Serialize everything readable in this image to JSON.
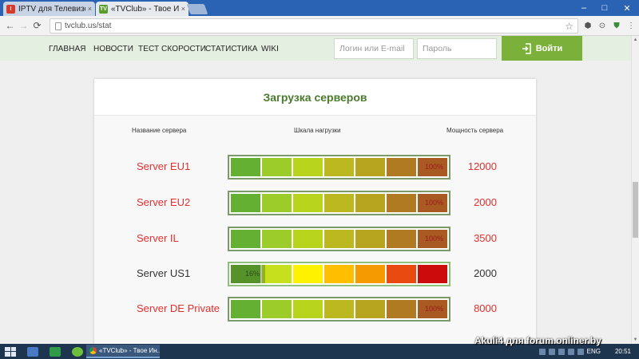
{
  "browser": {
    "tabs": [
      {
        "title": "IPTV для Телевизоров S",
        "close": "×",
        "favicon": "I",
        "favicon_color": "#d83b2b"
      },
      {
        "title": "«TVClub» - Твое Интер",
        "close": "×",
        "favicon": "TV",
        "favicon_color": "#5a9d2c"
      }
    ],
    "url": "tvclub.us/stat",
    "window_controls": {
      "minimize": "–",
      "maximize": "□",
      "close": "✕"
    }
  },
  "site": {
    "nav": [
      "ГЛАВНАЯ",
      "НОВОСТИ",
      "ТЕСТ СКОРОСТИ",
      "СТАТИСТИКА",
      "WIKI"
    ],
    "login_placeholder": "Логин или E-mail",
    "password_placeholder": "Пароль",
    "login_button": "Войти",
    "accent_color": "#7bb13b"
  },
  "card": {
    "title": "Загрузка серверов",
    "col_name": "Название сервера",
    "col_load": "Шкала нагрузки",
    "col_power": "Мощность сервера",
    "servers": [
      {
        "name": "Server EU1",
        "load_label": "100%",
        "load": 100,
        "power": "12000",
        "overloaded": true
      },
      {
        "name": "Server EU2",
        "load_label": "100%",
        "load": 100,
        "power": "2000",
        "overloaded": true
      },
      {
        "name": "Server IL",
        "load_label": "100%",
        "load": 100,
        "power": "3500",
        "overloaded": true
      },
      {
        "name": "Server US1",
        "load_label": "16%",
        "load": 16,
        "power": "2000",
        "overloaded": false
      },
      {
        "name": "Server DE Private",
        "load_label": "100%",
        "load": 100,
        "power": "8000",
        "overloaded": true
      }
    ],
    "scale_colors_full": [
      "#64b032",
      "#9ccc2a",
      "#b8d41c",
      "#bcb820",
      "#b7a41f",
      "#b07a22",
      "#a85a22"
    ],
    "scale_colors_bright": [
      "#64b032",
      "#c7e01e",
      "#fff200",
      "#ffbf00",
      "#f59a00",
      "#e84a10",
      "#cc0c0c"
    ]
  },
  "taskbar": {
    "task_title": "«TVClub» - Твое Ин...",
    "lang": "ENG",
    "time": "20:51"
  },
  "watermark": "Akuli4 для forum.onliner.by"
}
